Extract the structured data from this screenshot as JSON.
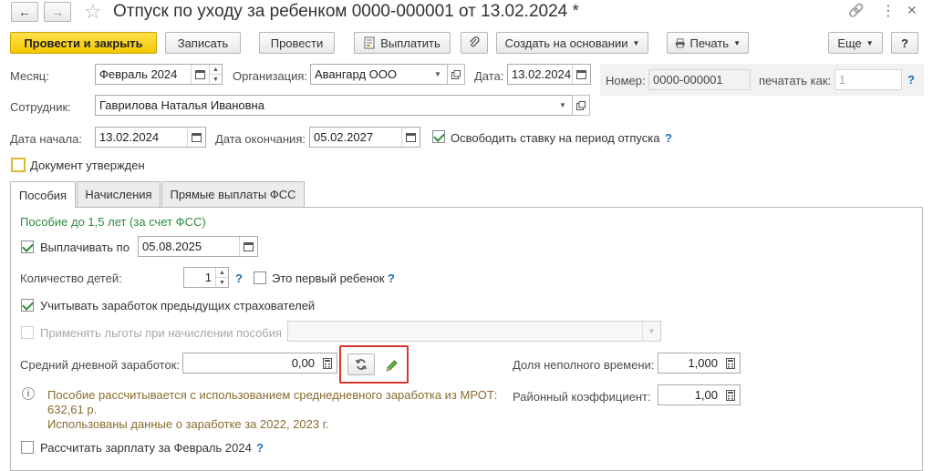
{
  "window": {
    "title": "Отпуск по уходу за ребенком 0000-000001 от 13.02.2024 *",
    "nav_back": "←",
    "nav_forward": "→",
    "star": "☆",
    "link_icon": "🔗",
    "menu_icon": "⋮",
    "close_icon": "✕"
  },
  "toolbar": {
    "post_close": "Провести и закрыть",
    "save": "Записать",
    "post": "Провести",
    "pay": "Выплатить",
    "create_based": "Создать на основании",
    "print": "Печать",
    "more": "Еще",
    "help": "?"
  },
  "header": {
    "month_label": "Месяц:",
    "month_value": "Февраль 2024",
    "org_label": "Организация:",
    "org_value": "Авангард ООО",
    "date_label": "Дата:",
    "date_value": "13.02.2024",
    "number_label": "Номер:",
    "number_value": "0000-000001",
    "print_as_label": "печатать как:",
    "print_as_value": "1",
    "employee_label": "Сотрудник:",
    "employee_value": "Гаврилова Наталья Ивановна",
    "start_label": "Дата начала:",
    "start_value": "13.02.2024",
    "end_label": "Дата окончания:",
    "end_value": "05.02.2027",
    "release_rate_label": "Освободить ставку на период отпуска",
    "approved_label": "Документ утвержден"
  },
  "tabs": [
    "Пособия",
    "Начисления",
    "Прямые выплаты ФСС"
  ],
  "benefits": {
    "section_title": "Пособие до 1,5 лет (за счет ФСС)",
    "pay_until_label": "Выплачивать по",
    "pay_until_value": "05.08.2025",
    "children_label": "Количество детей:",
    "children_value": "1",
    "first_child_label": "Это первый ребенок",
    "prev_insurers_label": "Учитывать заработок предыдущих страхователей",
    "apply_benefits_label": "Применять льготы при начислении пособия",
    "avg_daily_label": "Средний дневной заработок:",
    "avg_daily_value": "0,00",
    "part_time_label": "Доля неполного времени:",
    "part_time_value": "1,000",
    "regional_label": "Районный коэффициент:",
    "regional_value": "1,00",
    "info_line1": "Пособие рассчитывается с использованием среднедневного заработка из МРОТ:",
    "info_line2": "632,61 р.",
    "info_line3": "Использованы данные о заработке за  2022,  2023 г.",
    "recalc_label": "Рассчитать зарплату за Февраль 2024"
  },
  "colors": {
    "accent_yellow": "#f5c800",
    "green_text": "#2e8b3c",
    "info_text": "#8a6d2f",
    "highlight_red": "#d9372b",
    "help_blue": "#1e6fb8"
  }
}
